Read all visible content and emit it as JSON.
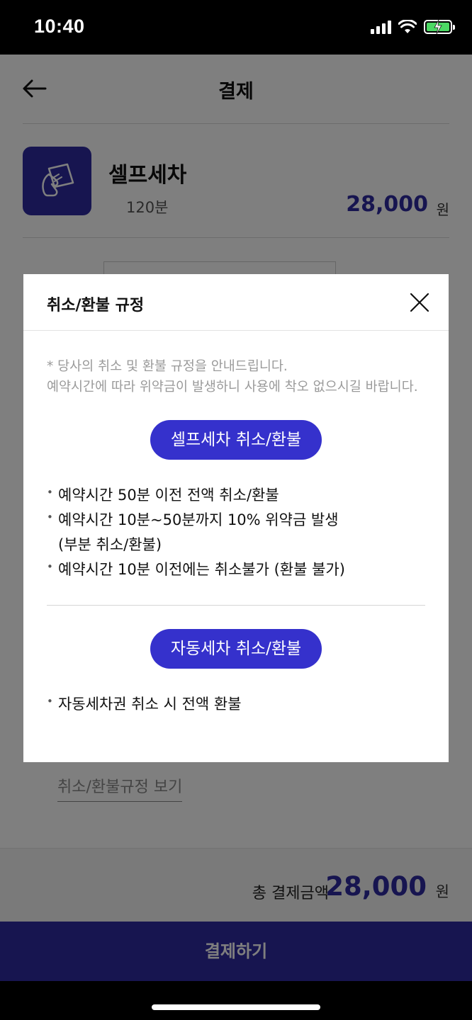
{
  "status_bar": {
    "time": "10:40"
  },
  "header": {
    "title": "결제"
  },
  "product": {
    "name": "셀프세차",
    "duration": "120분",
    "price": "28,000",
    "unit": "원"
  },
  "refund_link": "취소/환불규정 보기",
  "total": {
    "label": "총 결제금액",
    "amount": "28,000",
    "unit": "원"
  },
  "pay_button": "결제하기",
  "modal": {
    "title": "취소/환불 규정",
    "notice": [
      "* 당사의 취소 및 환불 규정을 안내드립니다.",
      "예약시간에 따라 위약금이 발생하니 사용에 착오 없으시길 바랍니다."
    ],
    "sections": [
      {
        "title": "셀프세차 취소/환불",
        "rules": [
          "예약시간 50분 이전 전액 취소/환불",
          "예약시간 10분~50분까지 10% 위약금 발생 (부분 취소/환불)",
          "예약시간 10분 이전에는 취소불가 (환불 불가)"
        ]
      },
      {
        "title": "자동세차 취소/환불",
        "rules": [
          "자동세차권 취소 시 전액 환불"
        ]
      }
    ]
  },
  "colors": {
    "brand": "#2e2ba0",
    "pill": "#3531cc",
    "overlay": "rgba(0,0,0,0.5)"
  }
}
